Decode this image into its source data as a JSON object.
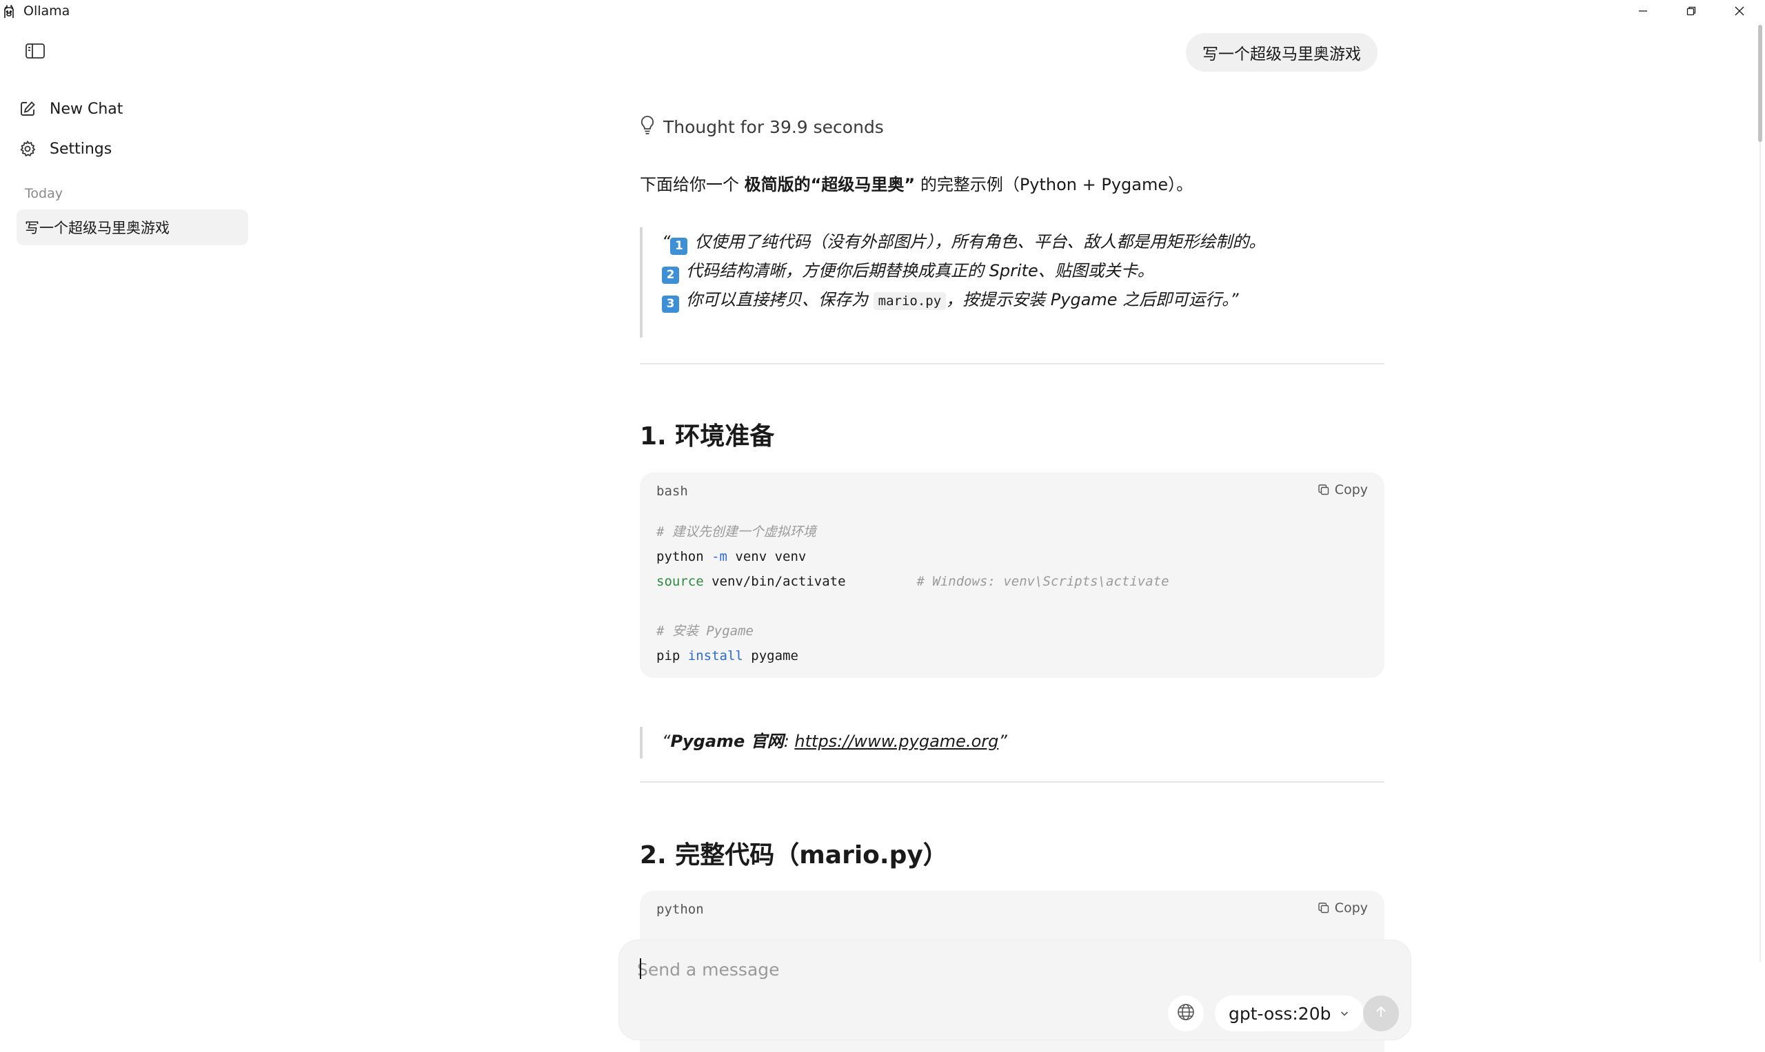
{
  "window": {
    "title": "Ollama",
    "icons": {
      "app": "llama-icon",
      "minimize": "minimize-icon",
      "maximize": "restore-icon",
      "close": "close-icon"
    }
  },
  "sidebar": {
    "new_chat": "New Chat",
    "settings": "Settings",
    "section_today": "Today",
    "chats": [
      {
        "title": "写一个超级马里奥游戏"
      }
    ]
  },
  "conversation": {
    "user_message": "写一个超级马里奥游戏",
    "thought": "Thought for 39.9 seconds",
    "intro": {
      "before": "下面给你一个 ",
      "bold": "极简版的“超级马里奥”",
      "after": " 的完整示例（Python + Pygame）。"
    },
    "quote1": {
      "open_mark": "“",
      "line1_badge": "1",
      "line1": "仅使用了纯代码（没有外部图片），所有角色、平台、敌人都是用矩形绘制的。",
      "line2_badge": "2",
      "line2": "代码结构清晰，方便你后期替换成真正的 Sprite、贴图或关卡。",
      "line3_badge": "3",
      "line3_before": "你可以直接拷贝、保存为 ",
      "line3_code": "mario.py",
      "line3_after": "，按提示安装 Pygame 之后即可运行。”"
    },
    "section1_title": "1. 环境准备",
    "code1": {
      "lang": "bash",
      "copy": "Copy",
      "comment1": "# 建议先创建一个虚拟环境",
      "l2_cmd": "python ",
      "l2_flag": "-m",
      "l2_rest": " venv venv",
      "l3_kw": "source",
      "l3_rest": " venv/bin/activate         ",
      "l3_comment": "# Windows: venv\\Scripts\\activate",
      "comment2": "# 安装 Pygame",
      "l6_cmd": "pip ",
      "l6_sub": "install",
      "l6_rest": " pygame"
    },
    "quote2": {
      "open_mark": "“",
      "bold": "Pygame 官网",
      "sep": ": ",
      "link": "https://www.pygame.org",
      "close_mark": "”"
    },
    "section2_title": "2. 完整代码（mario.py）",
    "code2": {
      "lang": "python",
      "copy": "Copy"
    }
  },
  "composer": {
    "placeholder": "Send a message",
    "model": "gpt-oss:20b",
    "icons": {
      "web_search": "globe-icon",
      "send": "arrow-up-icon",
      "model_dropdown": "chevron-down-icon"
    }
  }
}
